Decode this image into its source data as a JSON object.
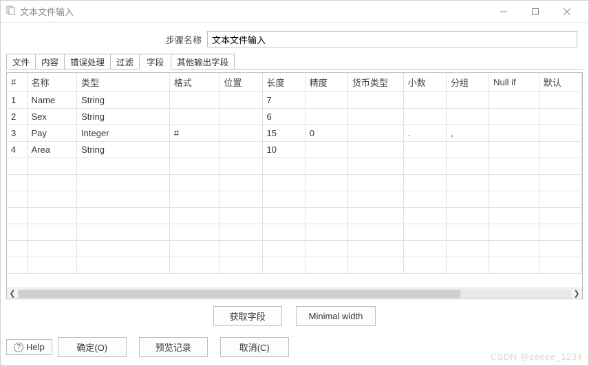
{
  "window": {
    "title": "文本文件输入",
    "min_icon": "minimize",
    "max_icon": "maximize",
    "close_icon": "close"
  },
  "step": {
    "label": "步骤名称",
    "value": "文本文件输入"
  },
  "tabs": [
    "文件",
    "内容",
    "错误处理",
    "过滤",
    "字段",
    "其他输出字段"
  ],
  "active_tab_index": 4,
  "columns": [
    "#",
    "名称",
    "类型",
    "格式",
    "位置",
    "长度",
    "精度",
    "货币类型",
    "小数",
    "分组",
    "Null if",
    "默认"
  ],
  "rows": [
    {
      "idx": "1",
      "name": "Name",
      "type": "String",
      "fmt": "",
      "pos": "",
      "len": "7",
      "prec": "",
      "curr": "",
      "dec": "",
      "grp": "",
      "nullif": "",
      "def": ""
    },
    {
      "idx": "2",
      "name": "Sex",
      "type": "String",
      "fmt": "",
      "pos": "",
      "len": "6",
      "prec": "",
      "curr": "",
      "dec": "",
      "grp": "",
      "nullif": "",
      "def": ""
    },
    {
      "idx": "3",
      "name": "Pay",
      "type": "Integer",
      "fmt": "#",
      "pos": "",
      "len": "15",
      "prec": "0",
      "curr": "",
      "dec": ".",
      "grp": ",",
      "nullif": "",
      "def": ""
    },
    {
      "idx": "4",
      "name": "Area",
      "type": "String",
      "fmt": "",
      "pos": "",
      "len": "10",
      "prec": "",
      "curr": "",
      "dec": "",
      "grp": "",
      "nullif": "",
      "def": ""
    }
  ],
  "mid_buttons": {
    "get_fields": "获取字段",
    "min_width": "Minimal width"
  },
  "footer": {
    "help": "Help",
    "ok": "确定(O)",
    "preview": "预览记录",
    "cancel": "取消(C)"
  },
  "watermark": "CSDN @zeeee_1234"
}
